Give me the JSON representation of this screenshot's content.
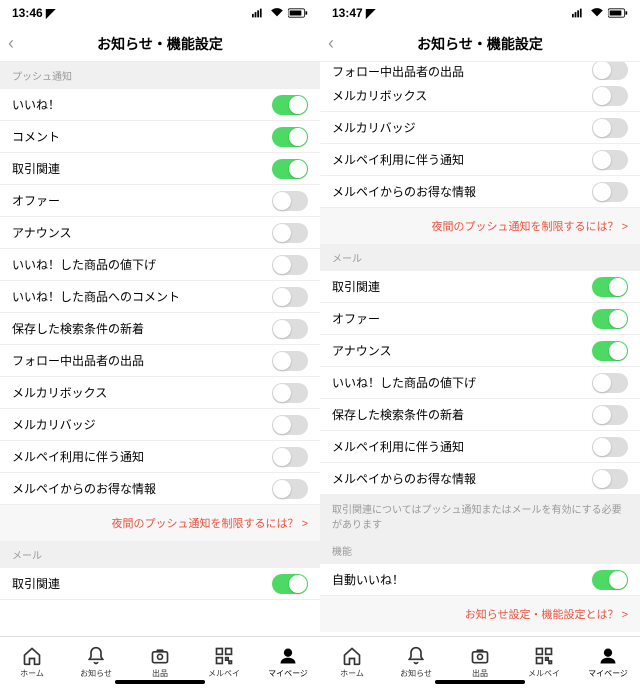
{
  "left": {
    "statusTime": "13:46",
    "navTitle": "お知らせ・機能設定",
    "sections": [
      {
        "type": "header",
        "label": "プッシュ通知"
      },
      {
        "type": "cell",
        "label": "いいね！",
        "on": true
      },
      {
        "type": "cell",
        "label": "コメント",
        "on": true
      },
      {
        "type": "cell",
        "label": "取引関連",
        "on": true
      },
      {
        "type": "cell",
        "label": "オファー",
        "on": false
      },
      {
        "type": "cell",
        "label": "アナウンス",
        "on": false
      },
      {
        "type": "cell",
        "label": "いいね！した商品の値下げ",
        "on": false
      },
      {
        "type": "cell",
        "label": "いいね！した商品へのコメント",
        "on": false
      },
      {
        "type": "cell",
        "label": "保存した検索条件の新着",
        "on": false
      },
      {
        "type": "cell",
        "label": "フォロー中出品者の出品",
        "on": false
      },
      {
        "type": "cell",
        "label": "メルカリボックス",
        "on": false
      },
      {
        "type": "cell",
        "label": "メルカリバッジ",
        "on": false
      },
      {
        "type": "cell",
        "label": "メルペイ利用に伴う通知",
        "on": false
      },
      {
        "type": "cell",
        "label": "メルペイからのお得な情報",
        "on": false
      },
      {
        "type": "link",
        "label": "夜間のプッシュ通知を制限するには？ >"
      },
      {
        "type": "header",
        "label": "メール"
      },
      {
        "type": "cell",
        "label": "取引関連",
        "on": true
      }
    ]
  },
  "right": {
    "statusTime": "13:47",
    "navTitle": "お知らせ・機能設定",
    "sections": [
      {
        "type": "partial",
        "label": "フォロー中出品者の出品",
        "on": false
      },
      {
        "type": "cell",
        "label": "メルカリボックス",
        "on": false
      },
      {
        "type": "cell",
        "label": "メルカリバッジ",
        "on": false
      },
      {
        "type": "cell",
        "label": "メルペイ利用に伴う通知",
        "on": false
      },
      {
        "type": "cell",
        "label": "メルペイからのお得な情報",
        "on": false
      },
      {
        "type": "link",
        "label": "夜間のプッシュ通知を制限するには？ >"
      },
      {
        "type": "header",
        "label": "メール"
      },
      {
        "type": "cell",
        "label": "取引関連",
        "on": true
      },
      {
        "type": "cell",
        "label": "オファー",
        "on": true
      },
      {
        "type": "cell",
        "label": "アナウンス",
        "on": true
      },
      {
        "type": "cell",
        "label": "いいね！した商品の値下げ",
        "on": false
      },
      {
        "type": "cell",
        "label": "保存した検索条件の新着",
        "on": false
      },
      {
        "type": "cell",
        "label": "メルペイ利用に伴う通知",
        "on": false
      },
      {
        "type": "cell",
        "label": "メルペイからのお得な情報",
        "on": false
      },
      {
        "type": "note",
        "label": "取引関連についてはプッシュ通知またはメールを有効にする必要があります"
      },
      {
        "type": "header",
        "label": "機能"
      },
      {
        "type": "cell",
        "label": "自動いいね！",
        "on": true
      },
      {
        "type": "link",
        "label": "お知らせ設定・機能設定とは？ >"
      }
    ]
  },
  "tabs": [
    {
      "label": "ホーム",
      "icon": "home"
    },
    {
      "label": "お知らせ",
      "icon": "bell"
    },
    {
      "label": "出品",
      "icon": "camera"
    },
    {
      "label": "メルペイ",
      "icon": "qr"
    },
    {
      "label": "マイページ",
      "icon": "person",
      "active": true
    }
  ]
}
